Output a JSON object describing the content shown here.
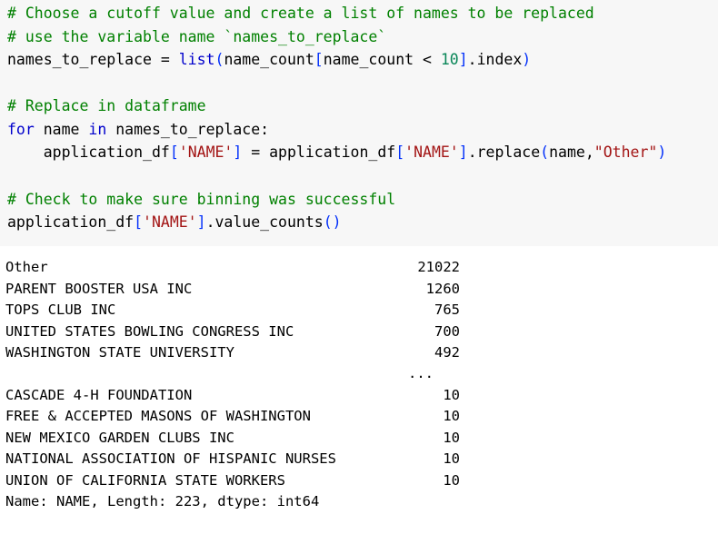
{
  "code": {
    "comment_1": "# Choose a cutoff value and create a list of names to be replaced",
    "comment_2": "# use the variable name `names_to_replace`",
    "line3": {
      "lhs": "names_to_replace = ",
      "fn": "list",
      "p1": "(",
      "arg_a": "name_count",
      "b1": "[",
      "arg_b": "name_count < ",
      "num": "10",
      "b2": "]",
      "attr": ".index",
      "p2": ")"
    },
    "comment_3": "# Replace in dataframe",
    "line6": {
      "kw_for": "for",
      "mid": " name ",
      "kw_in": "in",
      "rest": " names_to_replace:"
    },
    "line7": {
      "indent": "    ",
      "a": "application_df",
      "b1": "[",
      "s1": "'NAME'",
      "b2": "]",
      "eq": " = application_df",
      "b3": "[",
      "s2": "'NAME'",
      "b4": "]",
      "m": ".replace",
      "p1": "(",
      "arg": "name,",
      "s3": "\"Other\"",
      "p2": ")"
    },
    "comment_4": "# Check to make sure binning was successful",
    "line10": {
      "a": "application_df",
      "b1": "[",
      "s1": "'NAME'",
      "b2": "]",
      "m": ".value_counts",
      "p": "()"
    }
  },
  "output": {
    "top_rows": [
      {
        "name": "Other",
        "count": "21022"
      },
      {
        "name": "PARENT BOOSTER USA INC",
        "count": "1260"
      },
      {
        "name": "TOPS CLUB INC",
        "count": "765"
      },
      {
        "name": "UNITED STATES BOWLING CONGRESS INC",
        "count": "700"
      },
      {
        "name": "WASHINGTON STATE UNIVERSITY",
        "count": "492"
      }
    ],
    "ellipsis": "...",
    "bottom_rows": [
      {
        "name": "CASCADE 4-H FOUNDATION",
        "count": "10"
      },
      {
        "name": "FREE & ACCEPTED MASONS OF WASHINGTON",
        "count": "10"
      },
      {
        "name": "NEW MEXICO GARDEN CLUBS INC",
        "count": "10"
      },
      {
        "name": "NATIONAL ASSOCIATION OF HISPANIC NURSES",
        "count": "10"
      },
      {
        "name": "UNION OF CALIFORNIA STATE WORKERS",
        "count": "10"
      }
    ],
    "footer": "Name: NAME, Length: 223, dtype: int64"
  }
}
